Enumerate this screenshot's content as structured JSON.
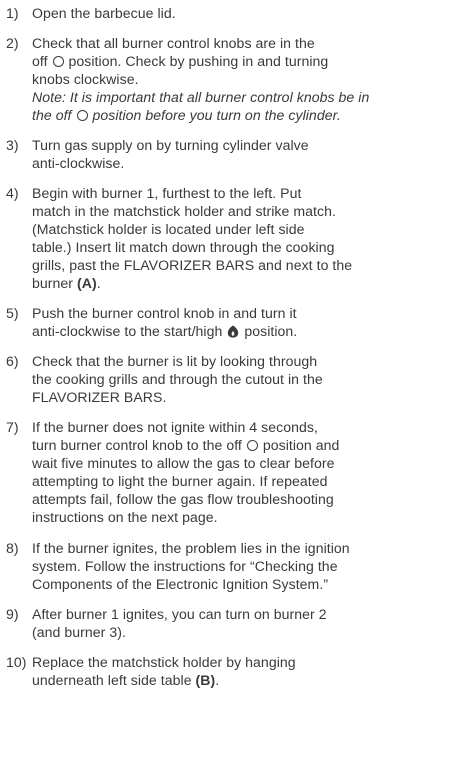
{
  "steps": [
    {
      "num": "1)",
      "lines": [
        "Open the barbecue lid."
      ]
    },
    {
      "num": "2)",
      "l1": "Check that all burner control knobs are in the",
      "l2a": "off ",
      "l2b": " position. Check by pushing in and turning",
      "l3": "knobs clockwise.",
      "note1": "Note: It is important that all burner control knobs be in",
      "note2a": "the off ",
      "note2b": " position before you turn on the cylinder."
    },
    {
      "num": "3)",
      "lines": [
        "Turn gas supply on by turning cylinder valve",
        "anti-clockwise."
      ]
    },
    {
      "num": "4)",
      "lines": [
        "Begin with burner 1, furthest to the left. Put",
        "match in the matchstick holder and strike match.",
        "(Matchstick holder is located under left side",
        "table.) Insert lit match down through the cooking",
        "grills, past the FLAVORIZER BARS and next to the"
      ],
      "last_a": "burner ",
      "last_b": "(A)",
      "last_c": "."
    },
    {
      "num": "5)",
      "l1": "Push the burner control knob in and turn it",
      "l2a": "anti-clockwise to the start/high ",
      "l2b": " position."
    },
    {
      "num": "6)",
      "lines": [
        "Check that the burner is lit by looking through",
        "the cooking grills and through the cutout in the",
        "FLAVORIZER BARS."
      ]
    },
    {
      "num": "7)",
      "l1": "If the burner does not ignite within 4 seconds,",
      "l2a": "turn burner control knob to the off ",
      "l2b": " position and",
      "rest": [
        "wait five minutes to allow the gas to clear before",
        "attempting to light the burner again. If repeated",
        "attempts fail, follow the gas flow troubleshooting",
        "instructions on the next page."
      ]
    },
    {
      "num": "8)",
      "lines": [
        "If the burner ignites, the problem lies in the ignition",
        "system. Follow the instructions for “Checking the",
        "Components of the Electronic Ignition System.”"
      ]
    },
    {
      "num": "9)",
      "lines": [
        "After burner 1 ignites, you can turn on burner 2",
        "(and burner 3)."
      ]
    },
    {
      "num": "10)",
      "l1": "Replace the matchstick holder by hanging",
      "l2a": "underneath left side table ",
      "l2b": "(B)",
      "l2c": "."
    }
  ],
  "icons": {
    "off": "off-position-circle-icon",
    "start_high": "start-high-flame-icon"
  }
}
